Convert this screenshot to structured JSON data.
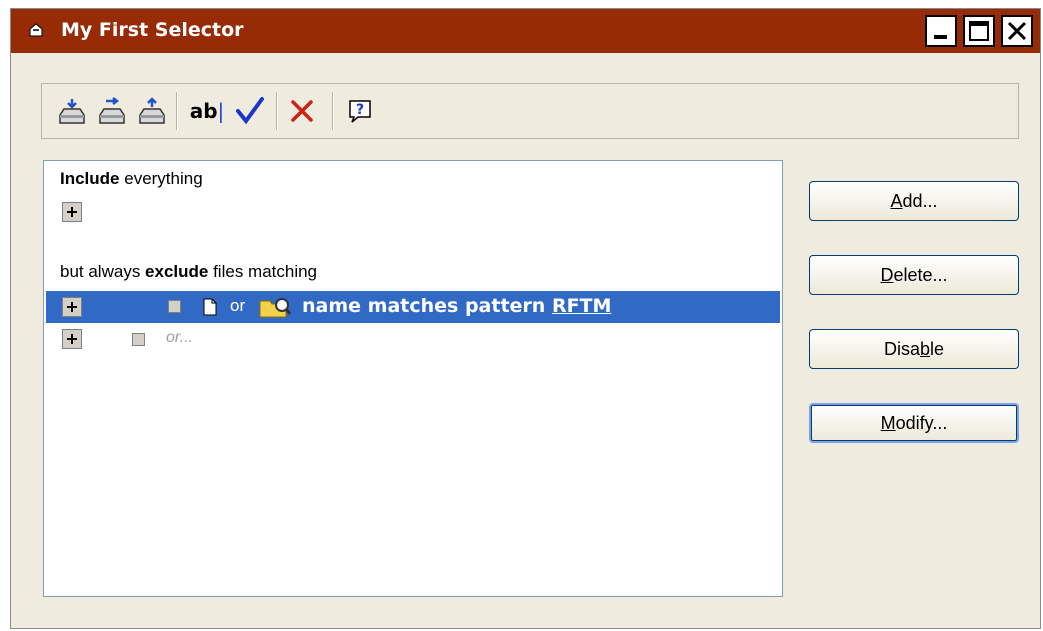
{
  "window": {
    "title": "My First Selector"
  },
  "icons": {
    "title": "selector-app-icon",
    "minimize": "minimize-icon",
    "maximize": "maximize-icon",
    "close": "close-icon",
    "toolbar": [
      "tray-add-icon",
      "tray-move-icon",
      "tray-up-icon",
      "rename-icon",
      "checkmark-icon",
      "delete-icon",
      "help-icon"
    ]
  },
  "toolbar": {
    "rename_label": "ab",
    "rename_cursor": "|"
  },
  "list": {
    "include_bold": "Include",
    "include_rest": " everything",
    "exclude_prefix": "but always ",
    "exclude_bold": "exclude",
    "exclude_rest": " files matching",
    "selected_row": {
      "or": "or",
      "condition": "name matches pattern ",
      "pattern": "RFTM"
    },
    "placeholder_or": "or..."
  },
  "buttons": {
    "add": {
      "pre": "",
      "acc": "A",
      "post": "dd..."
    },
    "delete": {
      "pre": "",
      "acc": "D",
      "post": "elete..."
    },
    "disable": {
      "pre": "Disa",
      "acc": "b",
      "post": "le"
    },
    "modify": {
      "pre": "",
      "acc": "M",
      "post": "odify..."
    }
  },
  "colors": {
    "titlebar": "#962b06",
    "selection": "#316ac5",
    "window_bg": "#efebdf"
  }
}
